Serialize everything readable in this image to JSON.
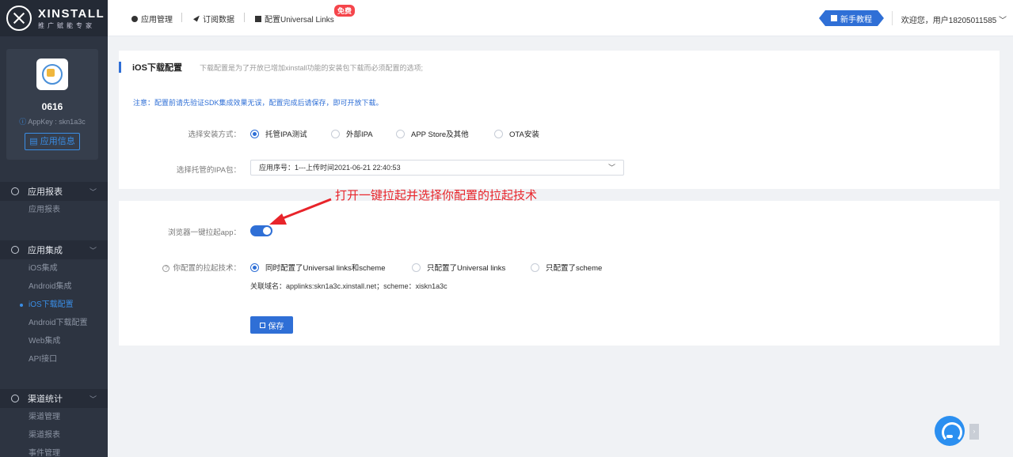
{
  "brand": {
    "title": "XINSTALL",
    "subtitle": "推广赋能专家"
  },
  "app": {
    "name": "0616",
    "appkey_label": "AppKey :",
    "appkey_value": "skn1a3c",
    "info_button": "应用信息"
  },
  "sidebar": {
    "groups": [
      {
        "label": "应用报表",
        "items": [
          "应用报表"
        ]
      },
      {
        "label": "应用集成",
        "items": [
          "iOS集成",
          "Android集成",
          "iOS下载配置",
          "Android下载配置",
          "Web集成",
          "API接口"
        ],
        "active": "iOS下载配置"
      },
      {
        "label": "渠道统计",
        "items": [
          "渠道管理",
          "渠道报表",
          "事件管理"
        ]
      }
    ]
  },
  "topbar": {
    "nav": [
      "应用管理",
      "订阅数据",
      "配置Universal Links"
    ],
    "free_badge": "免费",
    "guide_button": "新手教程",
    "welcome": "欢迎您，用户18205011585"
  },
  "section": {
    "title": "iOS下载配置",
    "description": "下载配置是为了开放已增加xinstall功能的安装包下载而必须配置的选项;",
    "notice": "注意：配置前请先验证SDK集成效果无误，配置完成后请保存，即可开放下载。",
    "install_label": "选择安装方式：",
    "install_options": [
      "托管IPA测试",
      "外部IPA",
      "APP Store及其他",
      "OTA安装"
    ],
    "install_selected": "托管IPA测试",
    "ipa_label": "选择托管的IPA包：",
    "ipa_value": "应用序号：1---上传时间2021-06-21 22:40:53"
  },
  "launch": {
    "toggle_label": "浏览器一键拉起app：",
    "toggle_on": true,
    "annotation": "打开一键拉起并选择你配置的拉起技术",
    "tech_label": "你配置的拉起技术：",
    "tech_options": [
      "同时配置了Universal links和scheme",
      "只配置了Universal links",
      "只配置了scheme"
    ],
    "tech_selected": "同时配置了Universal links和scheme",
    "domain_line": "关联域名：applinks:skn1a3c.xinstall.net；scheme：xiskn1a3c",
    "save_button": "保存"
  },
  "colors": {
    "accent": "#2f6fd6",
    "sidebar": "#2d3441",
    "annotation": "#e8242a",
    "badge": "#f5454b"
  }
}
